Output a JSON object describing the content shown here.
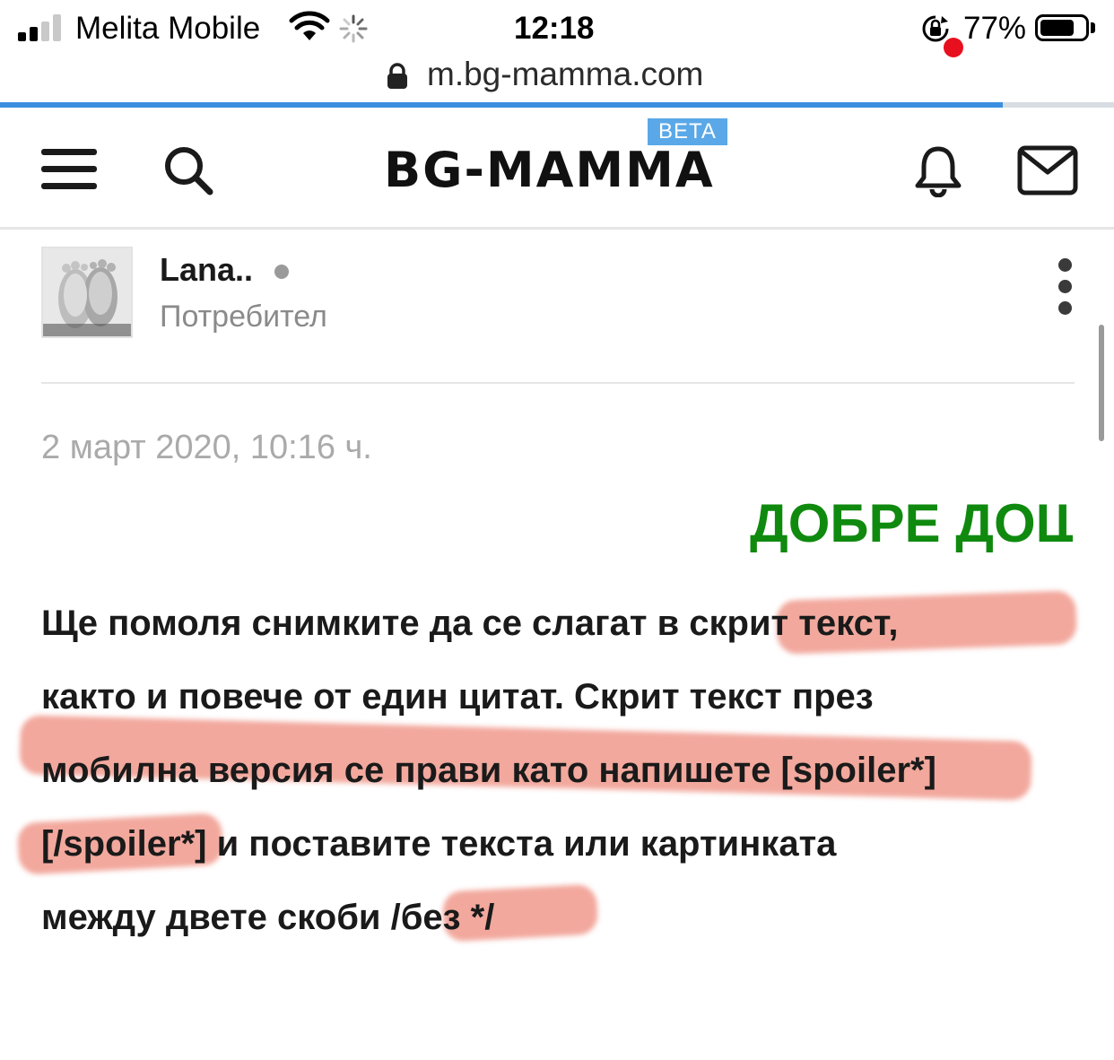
{
  "status_bar": {
    "carrier": "Melita Mobile",
    "time": "12:18",
    "battery_percent": "77%",
    "battery_level": 0.77
  },
  "browser": {
    "url": "m.bg-mamma.com",
    "load_progress": 0.9
  },
  "site_header": {
    "logo": "BG-MAMMA",
    "beta_badge": "BETA",
    "icons": [
      "menu-icon",
      "search-icon",
      "bell-icon",
      "mail-icon"
    ],
    "has_notification": true
  },
  "post": {
    "author": "Lana..",
    "role": "Потребител",
    "date": "2 март 2020, 10:16 ч.",
    "welcome_heading": "ДОБРЕ ДОШЛИ",
    "body_lines": [
      "Ще помоля снимките да се слагат в скрит текст,",
      "както и повече от един цитат. Скрит текст през",
      "мобилна версия се прави като напишете [spoiler*]",
      "[/spoiler*] и поставите текста или картинката",
      "между двете скоби /без */"
    ]
  },
  "colors": {
    "accent_blue": "#3b8fe0",
    "beta_blue": "#5aa8e8",
    "welcome_green": "#0f8a0f",
    "highlight_red": "#e8604c",
    "notification_red": "#e8101e"
  }
}
